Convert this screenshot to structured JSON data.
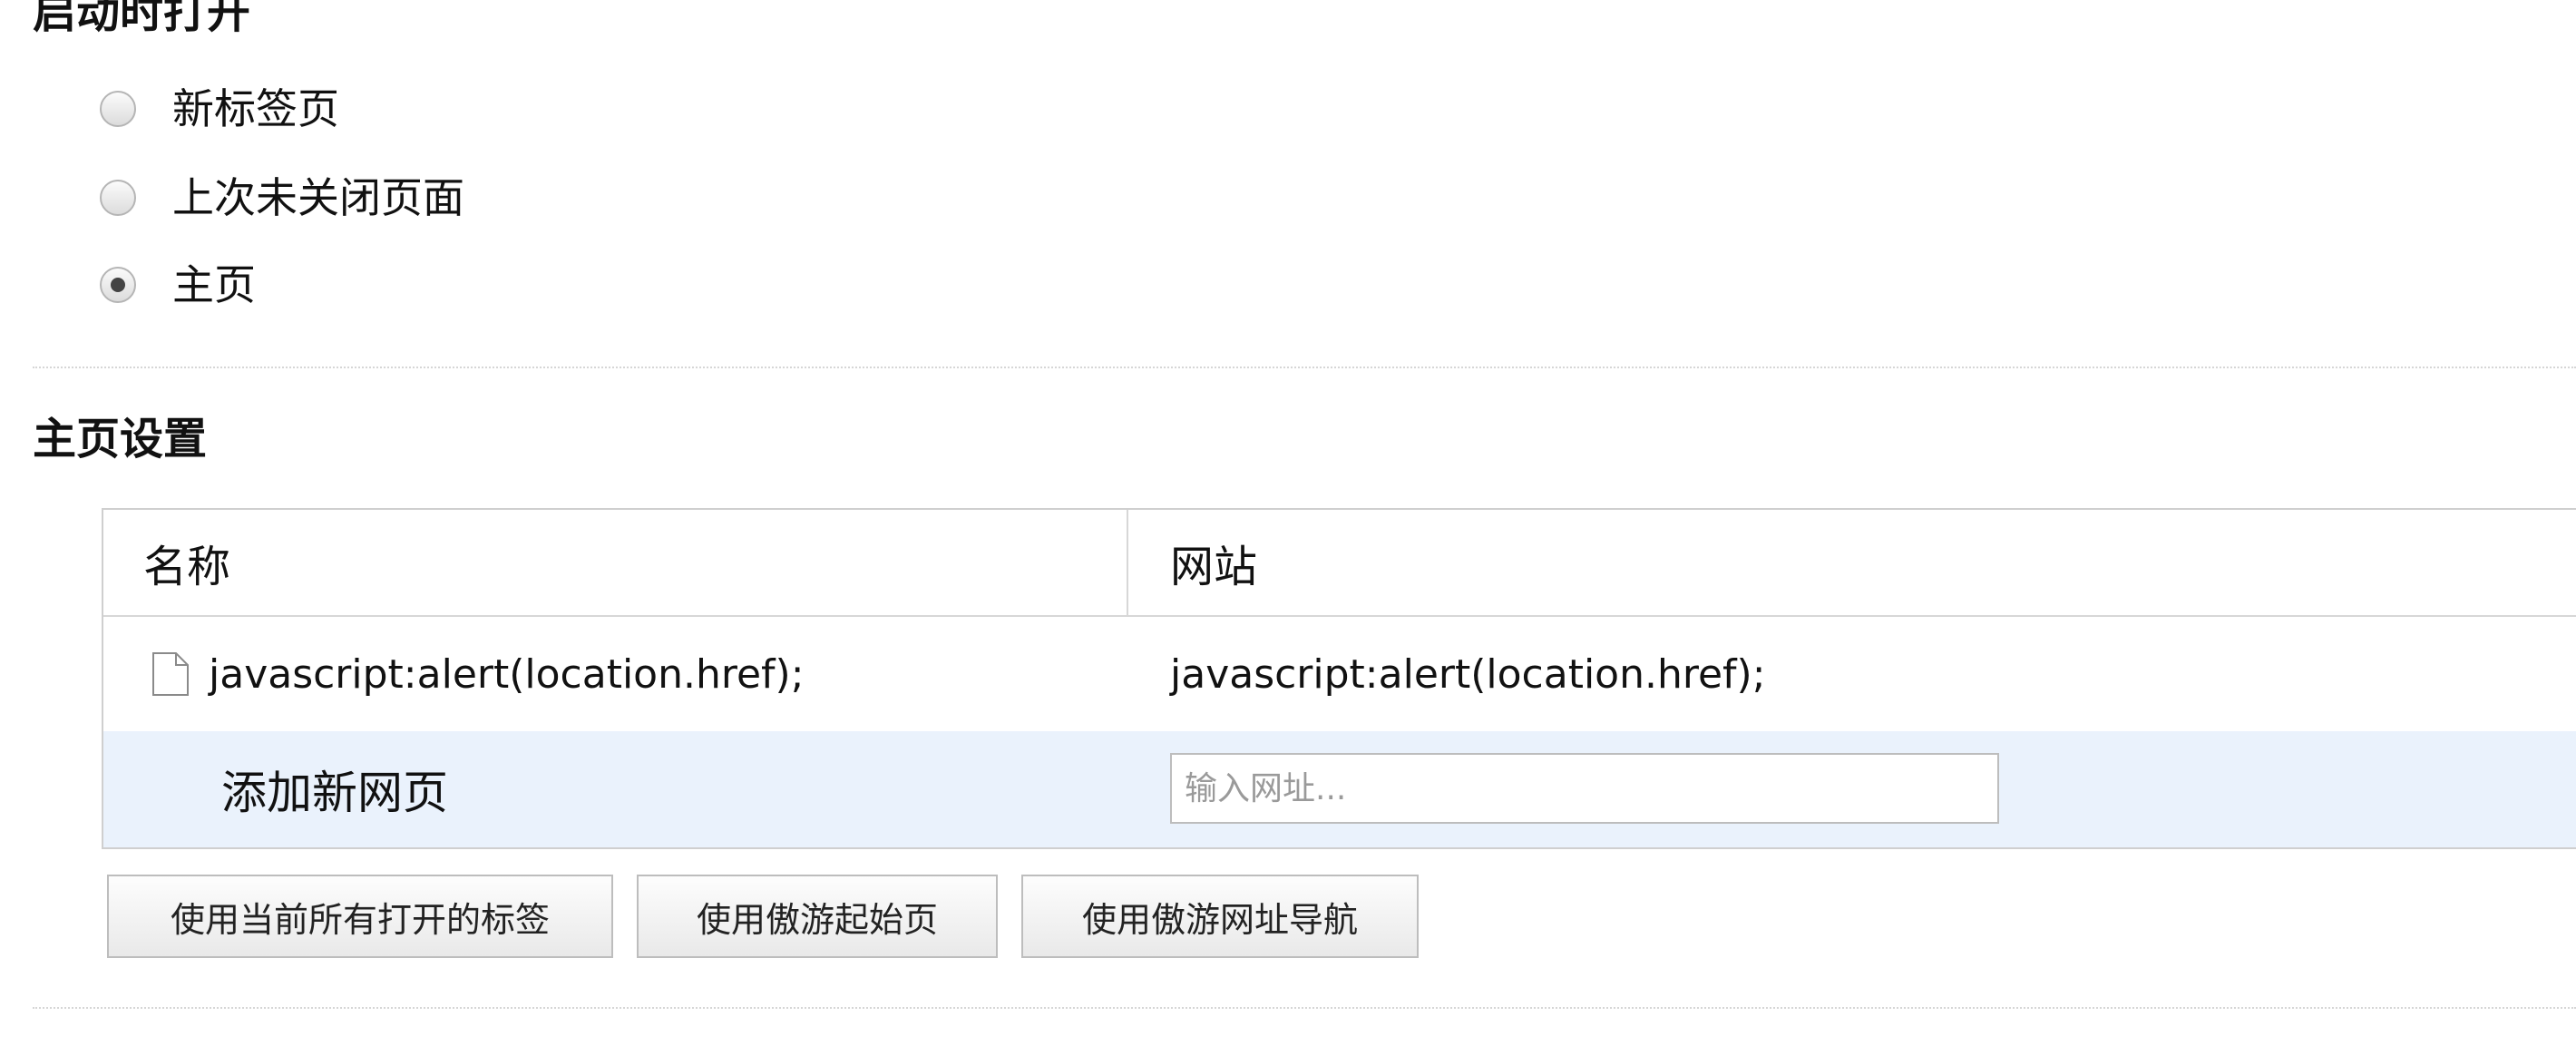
{
  "startup": {
    "title": "启动时打开",
    "options": [
      {
        "label": "新标签页",
        "checked": false
      },
      {
        "label": "上次未关闭页面",
        "checked": false
      },
      {
        "label": "主页",
        "checked": true
      }
    ]
  },
  "homepage": {
    "title": "主页设置",
    "table": {
      "headers": {
        "name": "名称",
        "site": "网站"
      },
      "rows": [
        {
          "name": "javascript:alert(location.href);",
          "site": "javascript:alert(location.href);",
          "icon": "file-icon"
        }
      ],
      "add_row": {
        "label": "添加新网页",
        "placeholder": "输入网址..."
      }
    },
    "buttons": {
      "use_open_tabs": "使用当前所有打开的标签",
      "use_maxthon_start": "使用傲游起始页",
      "use_maxthon_nav": "使用傲游网址导航"
    }
  },
  "colors": {
    "add_row_bg": "#eaf2fc",
    "border": "#cfcfcf",
    "radio_dot": "#444444"
  }
}
